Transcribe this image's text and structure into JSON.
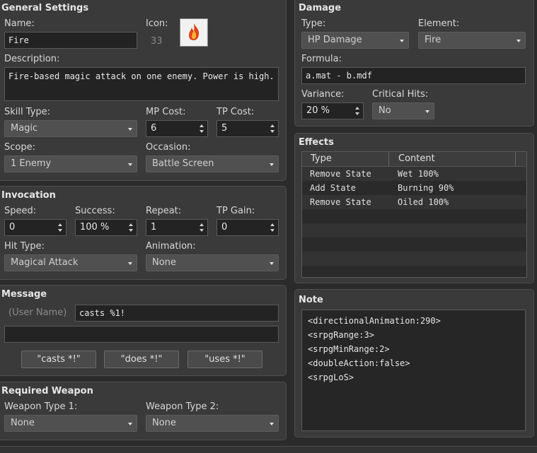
{
  "general": {
    "title": "General Settings",
    "name_label": "Name:",
    "name_value": "Fire",
    "icon_label": "Icon:",
    "icon_index": "33",
    "description_label": "Description:",
    "description_value": "Fire-based magic attack on one enemy. Power is high.",
    "skill_type_label": "Skill Type:",
    "skill_type_value": "Magic",
    "mp_cost_label": "MP Cost:",
    "mp_cost_value": "6",
    "tp_cost_label": "TP Cost:",
    "tp_cost_value": "5",
    "scope_label": "Scope:",
    "scope_value": "1 Enemy",
    "occasion_label": "Occasion:",
    "occasion_value": "Battle Screen"
  },
  "invocation": {
    "title": "Invocation",
    "speed_label": "Speed:",
    "speed_value": "0",
    "success_label": "Success:",
    "success_value": "100 %",
    "repeat_label": "Repeat:",
    "repeat_value": "1",
    "tp_gain_label": "TP Gain:",
    "tp_gain_value": "0",
    "hit_type_label": "Hit Type:",
    "hit_type_value": "Magical Attack",
    "animation_label": "Animation:",
    "animation_value": "None"
  },
  "message": {
    "title": "Message",
    "user_name_placeholder": "(User Name)",
    "line1_value": "casts %1!",
    "line2_value": "",
    "buttons": [
      "\"casts *!\"",
      "\"does *!\"",
      "\"uses *!\""
    ]
  },
  "required_weapon": {
    "title": "Required Weapon",
    "type1_label": "Weapon Type 1:",
    "type1_value": "None",
    "type2_label": "Weapon Type 2:",
    "type2_value": "None"
  },
  "damage": {
    "title": "Damage",
    "type_label": "Type:",
    "type_value": "HP Damage",
    "element_label": "Element:",
    "element_value": "Fire",
    "formula_label": "Formula:",
    "formula_value": "a.mat - b.mdf",
    "variance_label": "Variance:",
    "variance_value": "20 %",
    "critical_label": "Critical Hits:",
    "critical_value": "No"
  },
  "effects": {
    "title": "Effects",
    "columns": [
      "Type",
      "Content"
    ],
    "rows": [
      {
        "type": "Remove State",
        "content": "Wet 100%"
      },
      {
        "type": "Add State",
        "content": "Burning 90%"
      },
      {
        "type": "Remove State",
        "content": "Oiled 100%"
      }
    ]
  },
  "note": {
    "title": "Note",
    "lines": [
      "<directionalAnimation:290>",
      "<srpgRange:3>",
      "<srpgMinRange:2>",
      "<doubleAction:false>",
      "<srpgLoS>"
    ]
  },
  "icons": {
    "skill_icon": "fire-icon",
    "accent_fire": "#e0421a"
  }
}
